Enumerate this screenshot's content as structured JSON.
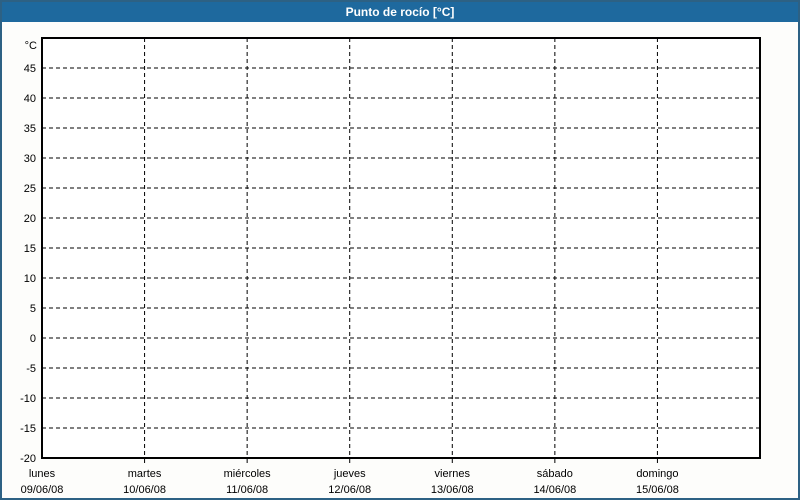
{
  "window": {
    "title": "Punto de rocío [°C]"
  },
  "colors": {
    "titlebar_bg": "#1e699e",
    "titlebar_text": "#ffffff",
    "window_border": "#2d6184",
    "content_bg": "#fdfdfb",
    "plot_bg": "#ffffff",
    "grid_line": "#000000",
    "label_text": "#000000"
  },
  "chart_data": {
    "type": "line",
    "title": "Punto de rocío [°C]",
    "series": [],
    "x_axis": {
      "columns": 7,
      "tick_labels": [
        {
          "day": "lunes",
          "date": "09/06/08"
        },
        {
          "day": "martes",
          "date": "10/06/08"
        },
        {
          "day": "miércoles",
          "date": "11/06/08"
        },
        {
          "day": "jueves",
          "date": "12/06/08"
        },
        {
          "day": "viernes",
          "date": "13/06/08"
        },
        {
          "day": "sábado",
          "date": "14/06/08"
        },
        {
          "day": "domingo",
          "date": "15/06/08"
        }
      ]
    },
    "y_axis": {
      "unit": "°C",
      "min": -20,
      "max": 50,
      "step": 5,
      "tick_labels": [
        "45",
        "40",
        "35",
        "30",
        "25",
        "20",
        "15",
        "10",
        "5",
        "0",
        "-5",
        "-10",
        "-15",
        "-20"
      ]
    },
    "grid": {
      "style": "dashed",
      "horizontal": true,
      "vertical": true
    },
    "legend": "none"
  }
}
